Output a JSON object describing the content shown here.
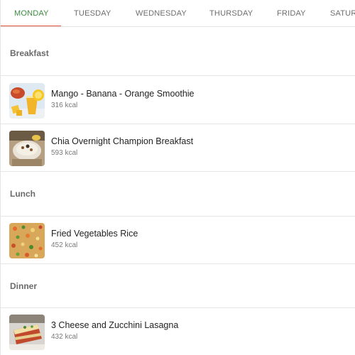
{
  "tabs": [
    {
      "label": "MONDAY",
      "active": true
    },
    {
      "label": "TUESDAY",
      "active": false
    },
    {
      "label": "WEDNESDAY",
      "active": false
    },
    {
      "label": "THURSDAY",
      "active": false
    },
    {
      "label": "FRIDAY",
      "active": false
    },
    {
      "label": "SATUR",
      "active": false
    }
  ],
  "sections": [
    {
      "title": "Breakfast",
      "meals": [
        {
          "name": "Mango - Banana - Orange Smoothie",
          "kcal": "316 kcal",
          "icon": "smoothie-photo"
        },
        {
          "name": "Chia Overnight Champion Breakfast",
          "kcal": "593 kcal",
          "icon": "chia-bowl-photo"
        }
      ]
    },
    {
      "title": "Lunch",
      "meals": [
        {
          "name": "Fried Vegetables Rice",
          "kcal": "452 kcal",
          "icon": "fried-rice-photo"
        }
      ]
    },
    {
      "title": "Dinner",
      "meals": [
        {
          "name": "3 Cheese and Zucchini Lasagna",
          "kcal": "432 kcal",
          "icon": "lasagna-photo"
        }
      ]
    }
  ],
  "colors": {
    "active_tab": "#3d8b40",
    "tab_indicator": "#e5533d",
    "inactive_tab": "#6e6e6e"
  }
}
